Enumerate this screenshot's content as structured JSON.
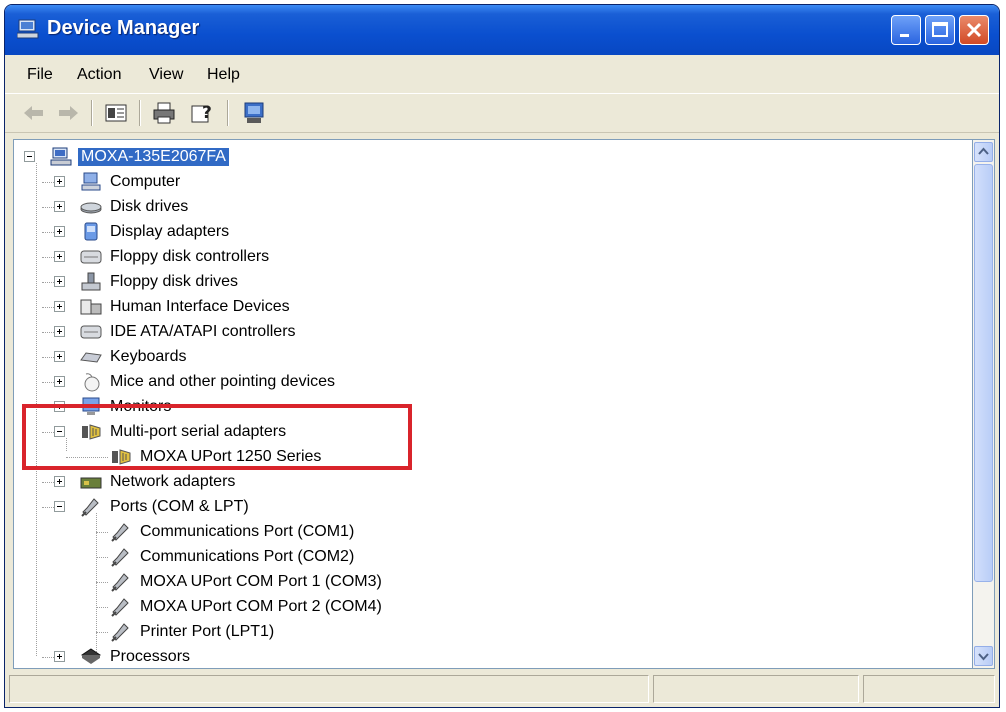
{
  "window": {
    "title": "Device Manager"
  },
  "menu": {
    "file": "File",
    "action": "Action",
    "view": "View",
    "help": "Help"
  },
  "toolbar": {
    "icons": [
      "back-icon",
      "forward-icon",
      "properties-view-icon",
      "print-icon",
      "help-icon",
      "scan-hardware-icon"
    ]
  },
  "tree": {
    "root": "MOXA-135E2067FA",
    "items": [
      "Computer",
      "Disk drives",
      "Display adapters",
      "Floppy disk controllers",
      "Floppy disk drives",
      "Human Interface Devices",
      "IDE ATA/ATAPI controllers",
      "Keyboards",
      "Mice and other pointing devices",
      "Monitors",
      "Multi-port serial adapters",
      "MOXA UPort 1250 Series",
      "Network adapters",
      "Ports (COM & LPT)",
      "Communications Port (COM1)",
      "Communications Port (COM2)",
      "MOXA UPort COM Port 1 (COM3)",
      "MOXA UPort COM Port 2 (COM4)",
      "Printer Port (LPT1)",
      "Processors"
    ]
  },
  "colors": {
    "titlebar": "#0a4fcf",
    "selection": "#316ac5",
    "highlight_box": "#d9242b"
  }
}
